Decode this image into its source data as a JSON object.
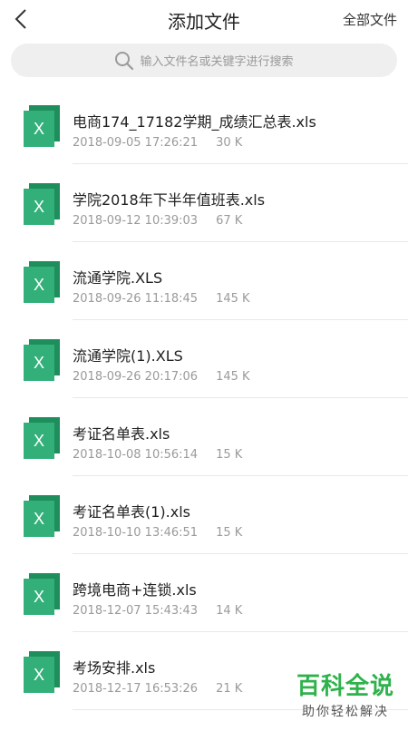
{
  "header": {
    "title": "添加文件",
    "all_files_label": "全部文件"
  },
  "search": {
    "placeholder": "输入文件名或关键字进行搜索"
  },
  "files": [
    {
      "name": "电商174_17182学期_成绩汇总表.xls",
      "date": "2018-09-05 17:26:21",
      "size": "30 K",
      "icon": "excel-file-icon"
    },
    {
      "name": "学院2018年下半年值班表.xls",
      "date": "2018-09-12 10:39:03",
      "size": "67 K",
      "icon": "excel-file-icon"
    },
    {
      "name": "流通学院.XLS",
      "date": "2018-09-26 11:18:45",
      "size": "145 K",
      "icon": "excel-file-icon"
    },
    {
      "name": "流通学院(1).XLS",
      "date": "2018-09-26 20:17:06",
      "size": "145 K",
      "icon": "excel-file-icon"
    },
    {
      "name": "考证名单表.xls",
      "date": "2018-10-08 10:56:14",
      "size": "15 K",
      "icon": "excel-file-icon"
    },
    {
      "name": "考证名单表(1).xls",
      "date": "2018-10-10 13:46:51",
      "size": "15 K",
      "icon": "excel-file-icon"
    },
    {
      "name": "跨境电商+连锁.xls",
      "date": "2018-12-07 15:43:43",
      "size": "14 K",
      "icon": "excel-file-icon"
    },
    {
      "name": "考场安排.xls",
      "date": "2018-12-17 16:53:26",
      "size": "21 K",
      "icon": "excel-file-icon"
    }
  ],
  "watermark": {
    "title": "百科全说",
    "subtitle": "助你轻松解决"
  },
  "colors": {
    "excel_green": "#33b07a",
    "excel_green_dark": "#1e8e5c",
    "watermark_green": "#2eb24b"
  }
}
